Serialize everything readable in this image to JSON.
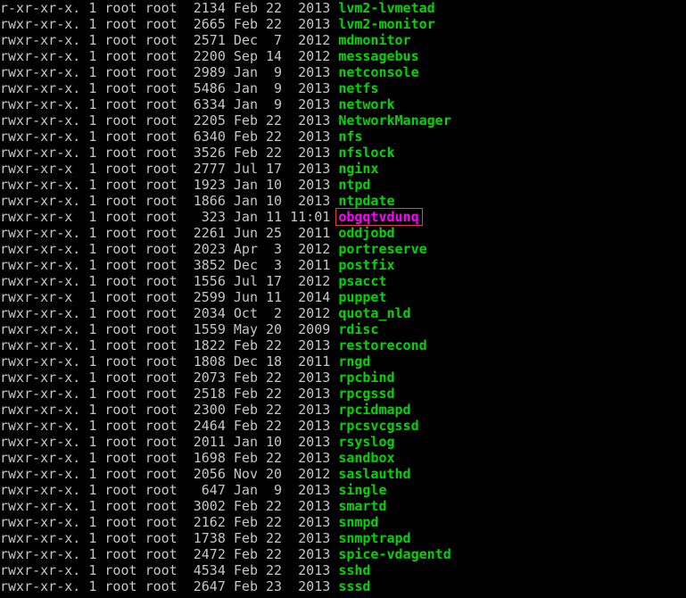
{
  "listing": [
    {
      "perm": "r-xr-xr-x.",
      "links": "1",
      "owner": "root",
      "group": "root",
      "size": "2134",
      "date": "Feb 22  2013",
      "name": "lvm2-lvmetad",
      "highlight": false
    },
    {
      "perm": "rwxr-xr-x.",
      "links": "1",
      "owner": "root",
      "group": "root",
      "size": "2665",
      "date": "Feb 22  2013",
      "name": "lvm2-monitor",
      "highlight": false
    },
    {
      "perm": "rwxr-xr-x.",
      "links": "1",
      "owner": "root",
      "group": "root",
      "size": "2571",
      "date": "Dec  7  2012",
      "name": "mdmonitor",
      "highlight": false
    },
    {
      "perm": "rwxr-xr-x.",
      "links": "1",
      "owner": "root",
      "group": "root",
      "size": "2200",
      "date": "Sep 14  2012",
      "name": "messagebus",
      "highlight": false
    },
    {
      "perm": "rwxr-xr-x.",
      "links": "1",
      "owner": "root",
      "group": "root",
      "size": "2989",
      "date": "Jan  9  2013",
      "name": "netconsole",
      "highlight": false
    },
    {
      "perm": "rwxr-xr-x.",
      "links": "1",
      "owner": "root",
      "group": "root",
      "size": "5486",
      "date": "Jan  9  2013",
      "name": "netfs",
      "highlight": false
    },
    {
      "perm": "rwxr-xr-x.",
      "links": "1",
      "owner": "root",
      "group": "root",
      "size": "6334",
      "date": "Jan  9  2013",
      "name": "network",
      "highlight": false
    },
    {
      "perm": "rwxr-xr-x.",
      "links": "1",
      "owner": "root",
      "group": "root",
      "size": "2205",
      "date": "Feb 22  2013",
      "name": "NetworkManager",
      "highlight": false
    },
    {
      "perm": "rwxr-xr-x.",
      "links": "1",
      "owner": "root",
      "group": "root",
      "size": "6340",
      "date": "Feb 22  2013",
      "name": "nfs",
      "highlight": false
    },
    {
      "perm": "rwxr-xr-x.",
      "links": "1",
      "owner": "root",
      "group": "root",
      "size": "3526",
      "date": "Feb 22  2013",
      "name": "nfslock",
      "highlight": false
    },
    {
      "perm": "rwxr-xr-x ",
      "links": "1",
      "owner": "root",
      "group": "root",
      "size": "2777",
      "date": "Jul 17  2013",
      "name": "nginx",
      "highlight": false
    },
    {
      "perm": "rwxr-xr-x.",
      "links": "1",
      "owner": "root",
      "group": "root",
      "size": "1923",
      "date": "Jan 10  2013",
      "name": "ntpd",
      "highlight": false
    },
    {
      "perm": "rwxr-xr-x.",
      "links": "1",
      "owner": "root",
      "group": "root",
      "size": "1866",
      "date": "Jan 10  2013",
      "name": "ntpdate",
      "highlight": false
    },
    {
      "perm": "rwxr-xr-x ",
      "links": "1",
      "owner": "root",
      "group": "root",
      "size": "323",
      "date": "Jan 11 11:01",
      "name": "obgqtvdunq",
      "highlight": true
    },
    {
      "perm": "rwxr-xr-x.",
      "links": "1",
      "owner": "root",
      "group": "root",
      "size": "2261",
      "date": "Jun 25  2011",
      "name": "oddjobd",
      "highlight": false
    },
    {
      "perm": "rwxr-xr-x.",
      "links": "1",
      "owner": "root",
      "group": "root",
      "size": "2023",
      "date": "Apr  3  2012",
      "name": "portreserve",
      "highlight": false
    },
    {
      "perm": "rwxr-xr-x.",
      "links": "1",
      "owner": "root",
      "group": "root",
      "size": "3852",
      "date": "Dec  3  2011",
      "name": "postfix",
      "highlight": false
    },
    {
      "perm": "rwxr-xr-x.",
      "links": "1",
      "owner": "root",
      "group": "root",
      "size": "1556",
      "date": "Jul 17  2012",
      "name": "psacct",
      "highlight": false
    },
    {
      "perm": "rwxr-xr-x ",
      "links": "1",
      "owner": "root",
      "group": "root",
      "size": "2599",
      "date": "Jun 11  2014",
      "name": "puppet",
      "highlight": false
    },
    {
      "perm": "rwxr-xr-x.",
      "links": "1",
      "owner": "root",
      "group": "root",
      "size": "2034",
      "date": "Oct  2  2012",
      "name": "quota_nld",
      "highlight": false
    },
    {
      "perm": "rwxr-xr-x.",
      "links": "1",
      "owner": "root",
      "group": "root",
      "size": "1559",
      "date": "May 20  2009",
      "name": "rdisc",
      "highlight": false
    },
    {
      "perm": "rwxr-xr-x.",
      "links": "1",
      "owner": "root",
      "group": "root",
      "size": "1822",
      "date": "Feb 22  2013",
      "name": "restorecond",
      "highlight": false
    },
    {
      "perm": "rwxr-xr-x.",
      "links": "1",
      "owner": "root",
      "group": "root",
      "size": "1808",
      "date": "Dec 18  2011",
      "name": "rngd",
      "highlight": false
    },
    {
      "perm": "rwxr-xr-x.",
      "links": "1",
      "owner": "root",
      "group": "root",
      "size": "2073",
      "date": "Feb 22  2013",
      "name": "rpcbind",
      "highlight": false
    },
    {
      "perm": "rwxr-xr-x.",
      "links": "1",
      "owner": "root",
      "group": "root",
      "size": "2518",
      "date": "Feb 22  2013",
      "name": "rpcgssd",
      "highlight": false
    },
    {
      "perm": "rwxr-xr-x.",
      "links": "1",
      "owner": "root",
      "group": "root",
      "size": "2300",
      "date": "Feb 22  2013",
      "name": "rpcidmapd",
      "highlight": false
    },
    {
      "perm": "rwxr-xr-x.",
      "links": "1",
      "owner": "root",
      "group": "root",
      "size": "2464",
      "date": "Feb 22  2013",
      "name": "rpcsvcgssd",
      "highlight": false
    },
    {
      "perm": "rwxr-xr-x.",
      "links": "1",
      "owner": "root",
      "group": "root",
      "size": "2011",
      "date": "Jan 10  2013",
      "name": "rsyslog",
      "highlight": false
    },
    {
      "perm": "rwxr-xr-x.",
      "links": "1",
      "owner": "root",
      "group": "root",
      "size": "1698",
      "date": "Feb 22  2013",
      "name": "sandbox",
      "highlight": false
    },
    {
      "perm": "rwxr-xr-x.",
      "links": "1",
      "owner": "root",
      "group": "root",
      "size": "2056",
      "date": "Nov 20  2012",
      "name": "saslauthd",
      "highlight": false
    },
    {
      "perm": "rwxr-xr-x.",
      "links": "1",
      "owner": "root",
      "group": "root",
      "size": "647",
      "date": "Jan  9  2013",
      "name": "single",
      "highlight": false
    },
    {
      "perm": "rwxr-xr-x.",
      "links": "1",
      "owner": "root",
      "group": "root",
      "size": "3002",
      "date": "Feb 22  2013",
      "name": "smartd",
      "highlight": false
    },
    {
      "perm": "rwxr-xr-x.",
      "links": "1",
      "owner": "root",
      "group": "root",
      "size": "2162",
      "date": "Feb 22  2013",
      "name": "snmpd",
      "highlight": false
    },
    {
      "perm": "rwxr-xr-x.",
      "links": "1",
      "owner": "root",
      "group": "root",
      "size": "1738",
      "date": "Feb 22  2013",
      "name": "snmptrapd",
      "highlight": false
    },
    {
      "perm": "rwxr-xr-x.",
      "links": "1",
      "owner": "root",
      "group": "root",
      "size": "2472",
      "date": "Feb 22  2013",
      "name": "spice-vdagentd",
      "highlight": false
    },
    {
      "perm": "rwxr-xr-x.",
      "links": "1",
      "owner": "root",
      "group": "root",
      "size": "4534",
      "date": "Feb 22  2013",
      "name": "sshd",
      "highlight": false
    },
    {
      "perm": "rwxr-xr-x.",
      "links": "1",
      "owner": "root",
      "group": "root",
      "size": "2647",
      "date": "Feb 23  2013",
      "name": "sssd",
      "highlight": false
    }
  ]
}
